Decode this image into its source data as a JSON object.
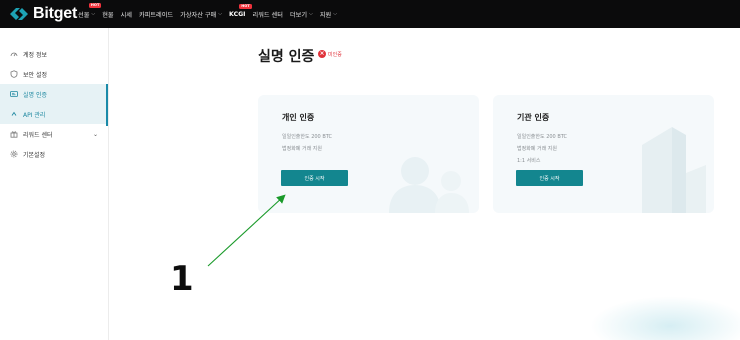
{
  "brand": {
    "name": "Bitget",
    "accent": "#1da2b4"
  },
  "nav": {
    "items": [
      {
        "label": "선물",
        "hot": true,
        "hot_label": "HOT",
        "dropdown": true
      },
      {
        "label": "현물",
        "hot": false,
        "dropdown": false
      },
      {
        "label": "시세",
        "hot": false,
        "dropdown": false
      },
      {
        "label": "카피트레이드",
        "hot": false,
        "dropdown": false
      },
      {
        "label": "가상자산 구매",
        "hot": false,
        "dropdown": true
      },
      {
        "label": "KCGI",
        "hot": true,
        "hot_label": "HOT",
        "dropdown": false
      },
      {
        "label": "리워드 센터",
        "hot": false,
        "dropdown": false
      },
      {
        "label": "더보기",
        "hot": false,
        "dropdown": true
      },
      {
        "label": "지원",
        "hot": false,
        "dropdown": true
      }
    ]
  },
  "sidebar": {
    "items": [
      {
        "label": "계정 정보",
        "icon": "gauge-icon"
      },
      {
        "label": "보안 설정",
        "icon": "shield-icon"
      },
      {
        "label": "실명 인증",
        "icon": "id-card-icon",
        "active": true
      },
      {
        "label": "API 관리",
        "icon": "api-icon",
        "active": true
      },
      {
        "label": "리워드 센터",
        "icon": "gift-icon",
        "expandable": true
      },
      {
        "label": "기본설정",
        "icon": "gear-icon"
      }
    ]
  },
  "main": {
    "title": "실명 인증",
    "status": "미인증",
    "status_color": "#e0323a"
  },
  "cards": {
    "personal": {
      "title": "개인 인증",
      "lines": [
        "일일인출한도 200 BTC",
        "법정화폐 거래 지원"
      ],
      "button": "인증 시작"
    },
    "institution": {
      "title": "기관 인증",
      "lines": [
        "일일인출한도 200 BTC",
        "법정화폐 거래 지원",
        "1:1 서비스"
      ],
      "button": "인증 시작"
    }
  },
  "annotation": {
    "step": "1",
    "arrow_color": "#1a9a2a"
  }
}
